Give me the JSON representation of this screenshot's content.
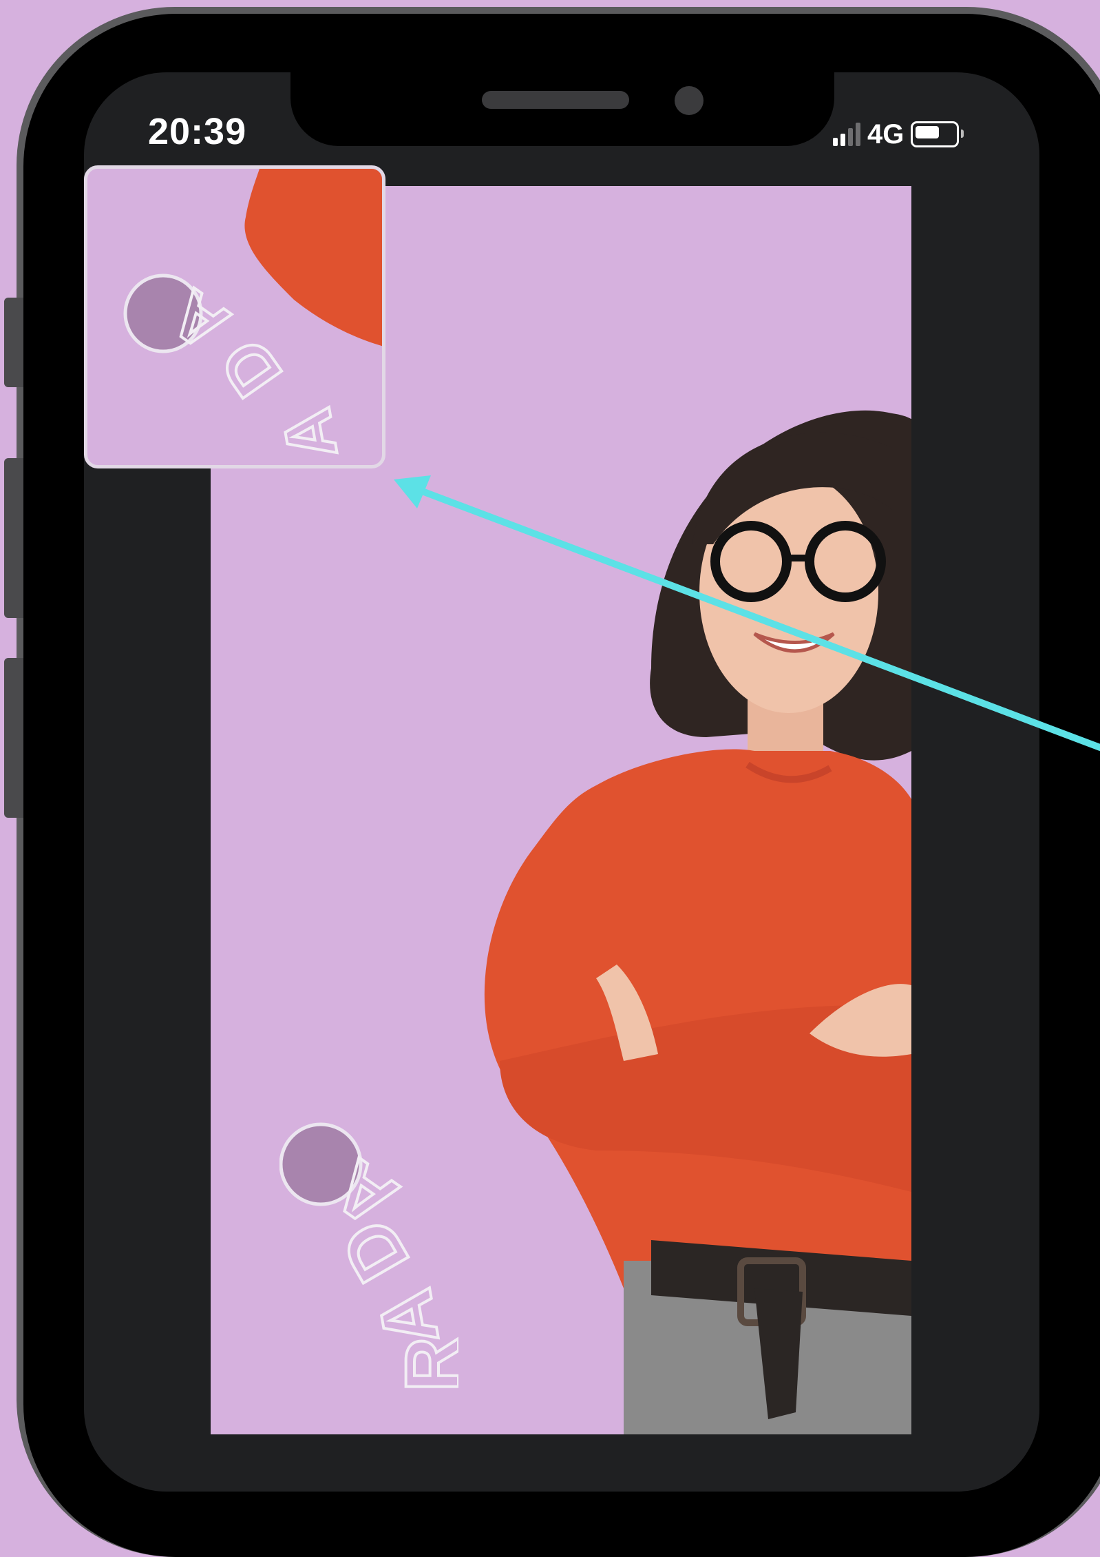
{
  "status_bar": {
    "time": "20:39",
    "network": "4G",
    "signal_icon": "signal-bars-icon",
    "battery_icon": "battery-icon"
  },
  "brand": {
    "logo_text": "RADA"
  },
  "colors": {
    "background": "#d6b1de",
    "screen": "#1f2022",
    "sweater": "#e0522f",
    "arrow": "#5ce1e6"
  }
}
